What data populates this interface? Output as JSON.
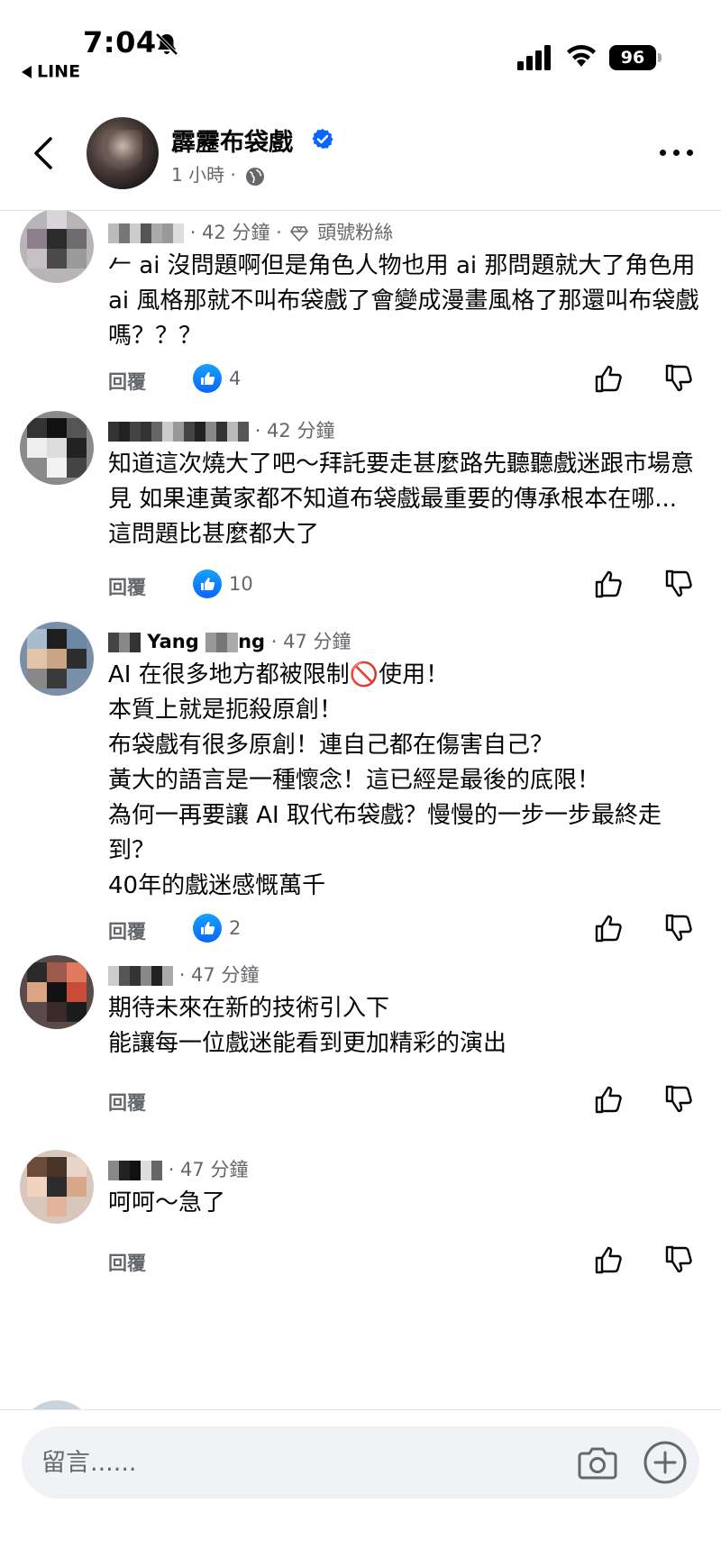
{
  "status_bar": {
    "time": "7:04",
    "back_app": "LINE",
    "battery": "96"
  },
  "header": {
    "page_name": "霹靂布袋戲",
    "post_time": "1 小時 ·"
  },
  "comments": [
    {
      "name": "▒▒▒",
      "time": "42 分鐘",
      "badge": "頭號粉絲",
      "text": "𠂉 ai 沒問題啊但是角色人物也用 ai 那問題就大了角色用 ai 風格那就不叫布袋戲了會變成漫畫風格了那還叫布袋戲嗎？？？",
      "reply_label": "回覆",
      "likes": "4"
    },
    {
      "name": "▒▒▒▒ ▒▒▒",
      "time": "42 分鐘",
      "text": "知道這次燒大了吧～拜託要走甚麼路先聽聽戲迷跟市場意見 如果連黃家都不知道布袋戲最重要的傳承根本在哪... 這問題比甚麼都大了",
      "reply_label": "回覆",
      "likes": "10"
    },
    {
      "name": "▒▒▒ Yang ▒▒ng",
      "time": "47 分鐘",
      "text": "AI 在很多地方都被限制🚫使用！\n本質上就是扼殺原創！\n布袋戲有很多原創！連自己都在傷害自己？\n黃大的語言是一種懷念！這已經是最後的底限！\n為何一再要讓 AI 取代布袋戲？慢慢的一步一步最終走到？\n40年的戲迷感慨萬千",
      "reply_label": "回覆",
      "likes": "2"
    },
    {
      "name": "▒▒",
      "time": "47 分鐘",
      "text": "期待未來在新的技術引入下\n能讓每一位戲迷能看到更加精彩的演出",
      "reply_label": "回覆",
      "likes": ""
    },
    {
      "name": "▒▒",
      "time": "47 分鐘",
      "text": "呵呵～急了",
      "reply_label": "回覆",
      "likes": ""
    }
  ],
  "composer": {
    "placeholder": "留言......"
  },
  "colors": {
    "accent": "#0866ff",
    "secondary_text": "#65676b",
    "primary_text": "#050505"
  },
  "icons": [
    "bell-off-icon",
    "signal-icon",
    "wifi-icon",
    "battery-icon",
    "back-arrow-icon",
    "verified-badge-icon",
    "globe-icon",
    "more-icon",
    "diamond-icon",
    "like-icon",
    "thumb-up-icon",
    "thumb-down-icon",
    "camera-icon",
    "add-icon"
  ]
}
